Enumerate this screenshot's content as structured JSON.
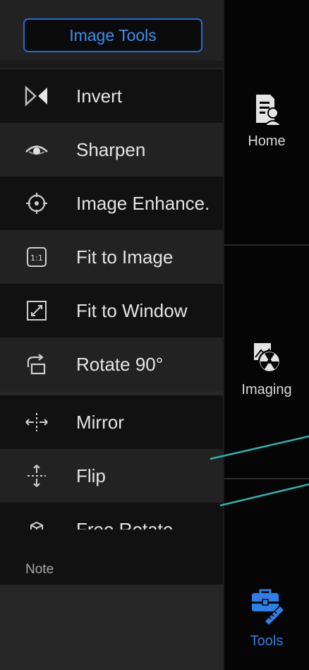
{
  "menu": {
    "header_button": "Image Tools",
    "items": [
      {
        "label": "Invert",
        "icon": "invert-icon"
      },
      {
        "label": "Sharpen",
        "icon": "eye-icon"
      },
      {
        "label": "Image Enhance.",
        "icon": "crosshair-icon"
      },
      {
        "label": "Fit to Image",
        "icon": "one-to-one-icon"
      },
      {
        "label": "Fit to Window",
        "icon": "expand-icon"
      },
      {
        "label": "Rotate 90°",
        "icon": "rotate-icon"
      },
      {
        "label": "Mirror",
        "icon": "mirror-icon"
      },
      {
        "label": "Flip",
        "icon": "flip-icon"
      },
      {
        "label": "Free Rotate",
        "icon": "free-rotate-icon"
      }
    ],
    "note_label": "Note"
  },
  "nav": {
    "items": [
      {
        "label": "Home",
        "icon": "home-icon"
      },
      {
        "label": "Imaging",
        "icon": "imaging-icon"
      },
      {
        "label": "Tools",
        "icon": "toolbox-icon",
        "active": true
      }
    ]
  },
  "colors": {
    "accent": "#2f7fe6",
    "callout_line": "#2bb5b0"
  }
}
